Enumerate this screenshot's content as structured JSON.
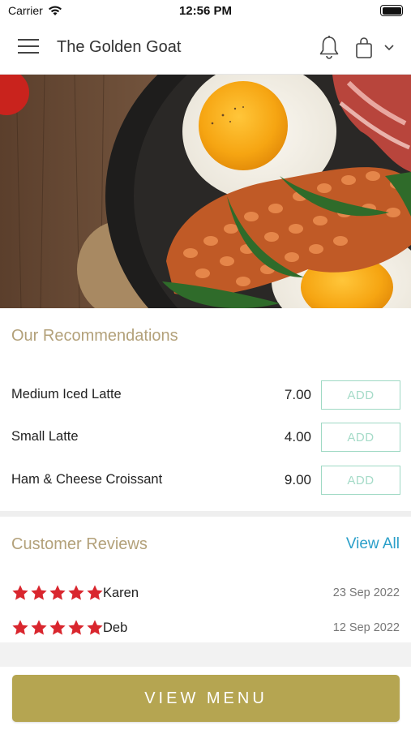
{
  "status_bar": {
    "carrier": "Carrier",
    "time": "12:56 PM"
  },
  "header": {
    "title": "The Golden Goat"
  },
  "recommendations": {
    "title": "Our Recommendations",
    "items": [
      {
        "name": "Medium Iced Latte",
        "price": "7.00",
        "button": "ADD"
      },
      {
        "name": "Small Latte",
        "price": "4.00",
        "button": "ADD"
      },
      {
        "name": "Ham & Cheese Croissant",
        "price": "9.00",
        "button": "ADD"
      }
    ]
  },
  "reviews": {
    "title": "Customer Reviews",
    "view_all": "View All",
    "items": [
      {
        "name": "Karen",
        "date": "23 Sep 2022",
        "rating": 5
      },
      {
        "name": "Deb",
        "date": "12 Sep 2022",
        "rating": 5
      }
    ]
  },
  "footer": {
    "view_menu": "VIEW MENU"
  },
  "colors": {
    "accent_gold": "#b5a551",
    "heading_tan": "#b3a17a",
    "add_green": "#9fd9c4",
    "link_blue": "#2a9fc9",
    "star_red": "#d9262e"
  },
  "icons": [
    "wifi-icon",
    "battery-icon",
    "hamburger-menu-icon",
    "bell-icon",
    "shopping-bag-icon",
    "chevron-down-icon",
    "star-icon"
  ]
}
